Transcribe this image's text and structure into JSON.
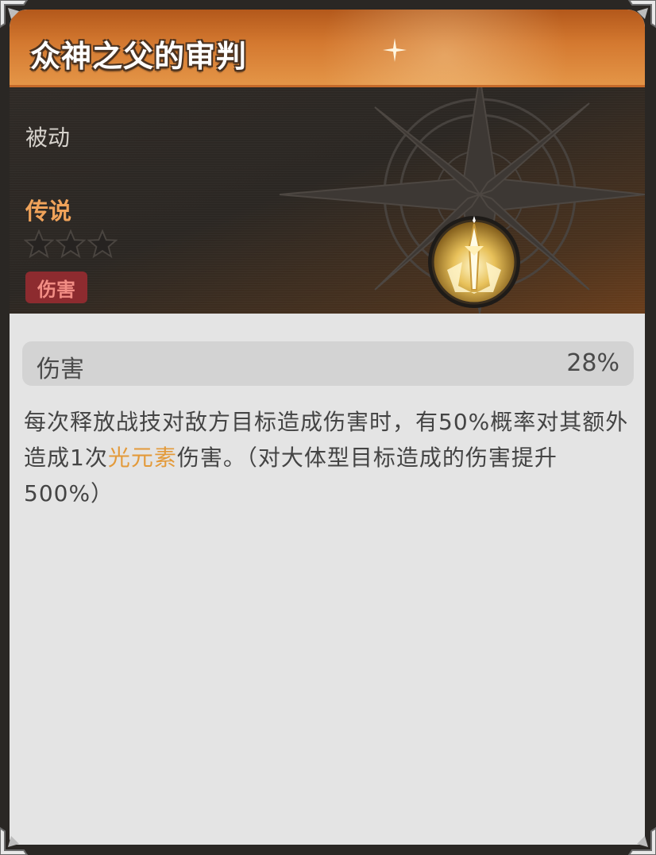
{
  "title": "众神之父的审判",
  "skill_type": "被动",
  "rarity": "传说",
  "star_rating": {
    "filled": 0,
    "total": 3
  },
  "tag": "伤害",
  "icon": "golden-sword-burst-icon",
  "stat": {
    "name": "伤害",
    "value": "28%"
  },
  "description": {
    "part1": "每次释放战技对敌方目标造成伤害时，有50%概率对其额外造成1次",
    "highlight": "光元素",
    "part2": "伤害。（对大体型目标造成的伤害提升500%）"
  },
  "colors": {
    "title_bar": "#d47930",
    "rarity": "#f0a35a",
    "tag_bg": "#8d2b2f",
    "tag_text": "#f28d84",
    "highlight": "#e39a3a",
    "body_bg": "#e4e4e4"
  }
}
